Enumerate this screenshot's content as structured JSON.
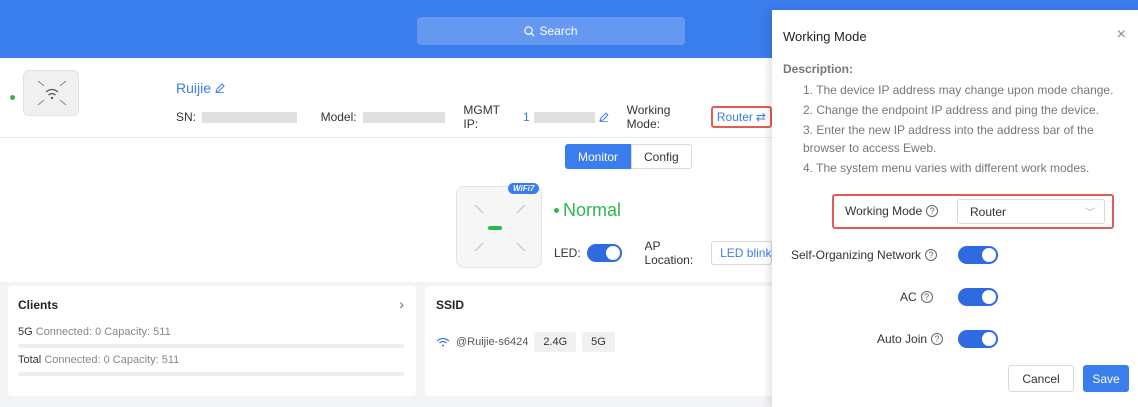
{
  "topbar": {
    "search_label": "Search"
  },
  "device": {
    "name": "Ruijie",
    "sn_label": "SN:",
    "model_label": "Model:",
    "mgmt_ip_label": "MGMT IP:",
    "mgmt_ip_partial": "1",
    "working_mode_label": "Working Mode:",
    "working_mode_value": "Router"
  },
  "tabs": {
    "monitor": "Monitor",
    "config": "Config"
  },
  "ap": {
    "badge": "WiFi7",
    "status": "Normal",
    "led_label": "LED:",
    "location_label": "AP Location:",
    "location_button": "LED blink"
  },
  "clients": {
    "title": "Clients",
    "rows": [
      {
        "band": "5G",
        "text": "Connected: 0  Capacity: 511"
      },
      {
        "band": "Total",
        "text": "Connected: 0  Capacity: 511"
      }
    ]
  },
  "ssid": {
    "title": "SSID",
    "name": "@Ruijie-s6424",
    "bands": [
      "2.4G",
      "5G"
    ]
  },
  "drawer": {
    "title": "Working Mode",
    "description_label": "Description:",
    "items": [
      "1. The device IP address may change upon mode change.",
      "2. Change the endpoint IP address and ping the device.",
      "3. Enter the new IP address into the address bar of the browser to access Eweb.",
      "4. The system menu varies with different work modes."
    ],
    "working_mode_label": "Working Mode",
    "working_mode_value": "Router",
    "self_org_label": "Self-Organizing Network",
    "ac_label": "AC",
    "auto_join_label": "Auto Join",
    "cancel_label": "Cancel",
    "save_label": "Save"
  }
}
